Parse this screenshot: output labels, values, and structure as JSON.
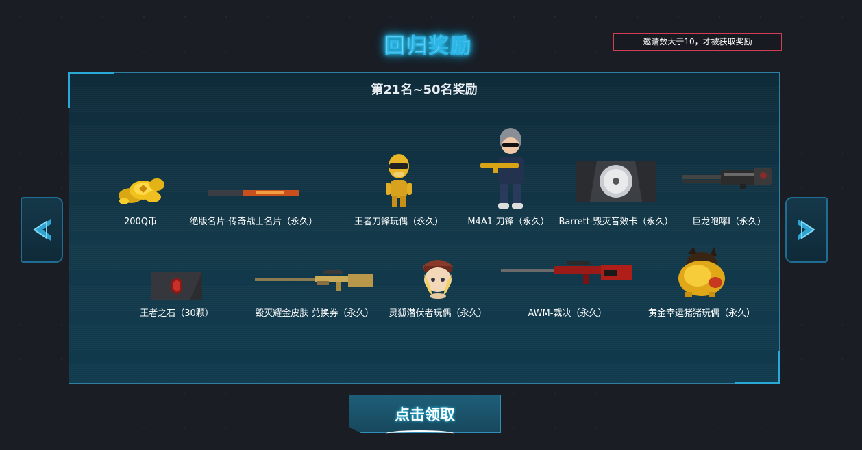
{
  "page": {
    "title": "回归奖励",
    "notice": "邀请数大于10，才被获取奖励",
    "claim_button": "点击领取"
  },
  "panel": {
    "title": "第21名~50名奖励",
    "rewards": [
      {
        "label": "200Q币",
        "icon": "gold-coins-icon"
      },
      {
        "label": "绝版名片-传奇战士名片（永久）",
        "icon": "name-card-icon"
      },
      {
        "label": "王者刀锋玩偶（永久）",
        "icon": "golden-doll-icon"
      },
      {
        "label": "M4A1-刀锋（永久）",
        "icon": "soldier-character-icon"
      },
      {
        "label": "Barrett-毁灭音效卡（永久）",
        "icon": "sound-card-icon"
      },
      {
        "label": "巨龙咆哮I（永久）",
        "icon": "gatling-gun-icon"
      },
      {
        "label": "王者之石（30颗）",
        "icon": "king-stone-icon"
      },
      {
        "label": "毁灭耀金皮肤 兑换券（永久）",
        "icon": "golden-sniper-rifle-icon"
      },
      {
        "label": "灵狐潜伏者玩偶（永久）",
        "icon": "fox-doll-icon"
      },
      {
        "label": "AWM-裁决（永久）",
        "icon": "red-sniper-rifle-icon"
      },
      {
        "label": "黄金幸运猪猪玩偶（永久）",
        "icon": "golden-pig-icon"
      }
    ]
  },
  "colors": {
    "accent": "#2ad1ff",
    "panel": "#12394a",
    "notice_border": "#d23c55"
  }
}
